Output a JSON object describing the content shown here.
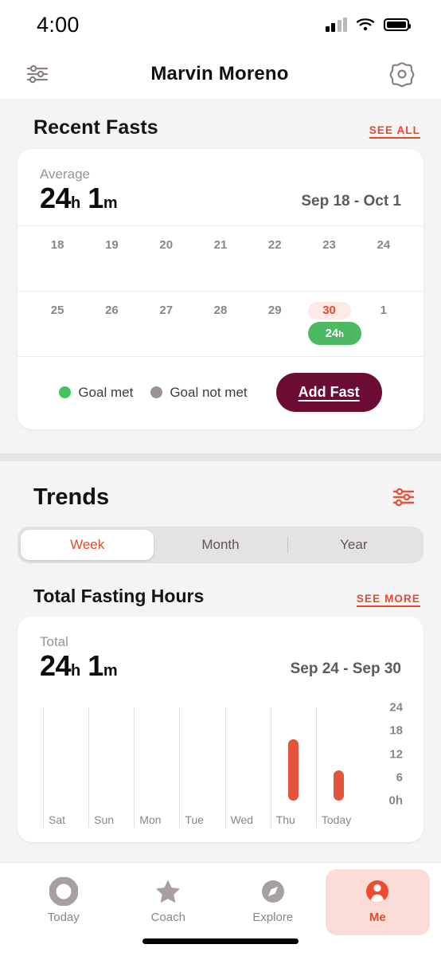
{
  "status_bar": {
    "time": "4:00",
    "signal_icon": "cellular-signal-icon",
    "wifi_icon": "wifi-icon",
    "battery_icon": "battery-icon"
  },
  "header": {
    "filter_icon": "sliders-filter-icon",
    "title": "Marvin Moreno",
    "settings_icon": "gear-icon"
  },
  "recent_fasts": {
    "title": "Recent Fasts",
    "see_all": "SEE ALL",
    "average_label": "Average",
    "average_hours": "24",
    "average_hours_unit": "h",
    "average_minutes": "1",
    "average_minutes_unit": "m",
    "date_range": "Sep 18 - Oct 1",
    "weeks": [
      [
        {
          "day": "18",
          "today": false,
          "fast": null
        },
        {
          "day": "19",
          "today": false,
          "fast": null
        },
        {
          "day": "20",
          "today": false,
          "fast": null
        },
        {
          "day": "21",
          "today": false,
          "fast": null
        },
        {
          "day": "22",
          "today": false,
          "fast": null
        },
        {
          "day": "23",
          "today": false,
          "fast": null
        },
        {
          "day": "24",
          "today": false,
          "fast": null
        }
      ],
      [
        {
          "day": "25",
          "today": false,
          "fast": null
        },
        {
          "day": "26",
          "today": false,
          "fast": null
        },
        {
          "day": "27",
          "today": false,
          "fast": null
        },
        {
          "day": "28",
          "today": false,
          "fast": null
        },
        {
          "day": "29",
          "today": false,
          "fast": null
        },
        {
          "day": "30",
          "today": true,
          "fast": {
            "value": "24",
            "unit": "h",
            "goal_met": true
          }
        },
        {
          "day": "1",
          "today": false,
          "fast": null
        }
      ]
    ],
    "legend": [
      {
        "label": "Goal met",
        "color": "#3fc45f"
      },
      {
        "label": "Goal not met",
        "color": "#9d9197"
      }
    ],
    "add_fast_label": "Add Fast",
    "add_fast_color": "#6b0d33"
  },
  "trends": {
    "title": "Trends",
    "filter_icon": "sliders-filter-icon",
    "filter_icon_color": "#e4533b",
    "segments": [
      {
        "label": "Week",
        "active": true
      },
      {
        "label": "Month",
        "active": false
      },
      {
        "label": "Year",
        "active": false
      }
    ]
  },
  "total_fasting_hours": {
    "title": "Total Fasting Hours",
    "see_more": "SEE MORE",
    "total_label": "Total",
    "total_hours": "24",
    "total_hours_unit": "h",
    "total_minutes": "1",
    "total_minutes_unit": "m",
    "date_range": "Sep 24 - Sep 30"
  },
  "chart_data": {
    "type": "bar",
    "title": "Total Fasting Hours",
    "categories": [
      "Sat",
      "Sun",
      "Mon",
      "Tue",
      "Wed",
      "Thu",
      "Today"
    ],
    "values": [
      0,
      0,
      0,
      0,
      0,
      15.8,
      7.9
    ],
    "series": [
      {
        "name": "Fasting hours",
        "values": [
          0,
          0,
          0,
          0,
          0,
          15.8,
          7.9
        ],
        "color": "#e4533b"
      }
    ],
    "xlabel": "",
    "ylabel": "",
    "ylim": [
      0,
      24
    ],
    "yticks": [
      0,
      6,
      12,
      18,
      24
    ],
    "ytick_labels": [
      "0h",
      "6",
      "12",
      "18",
      "24"
    ],
    "grid": "vertical",
    "legend": "none"
  },
  "tab_bar": {
    "tabs": [
      {
        "label": "Today",
        "icon": "ring-icon",
        "active": false
      },
      {
        "label": "Coach",
        "icon": "star-icon",
        "active": false
      },
      {
        "label": "Explore",
        "icon": "compass-icon",
        "active": false
      },
      {
        "label": "Me",
        "icon": "person-icon",
        "active": true
      }
    ],
    "active_color": "#e8492c",
    "inactive_color": "#a99ea4"
  }
}
